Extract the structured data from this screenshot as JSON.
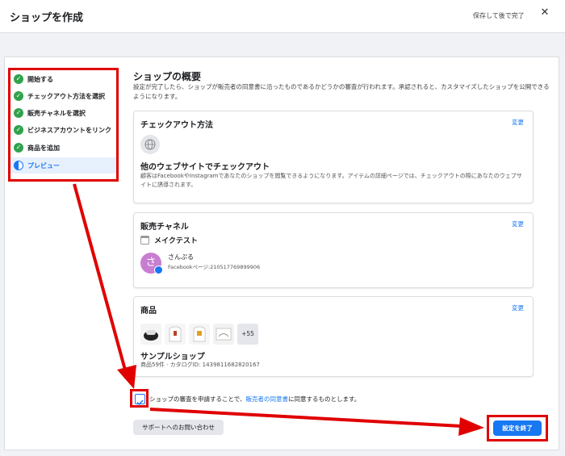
{
  "header": {
    "title": "ショップを作成",
    "save_later": "保存して後で完了",
    "close": "✕"
  },
  "sidebar": {
    "steps": [
      {
        "label": "開始する",
        "state": "done"
      },
      {
        "label": "チェックアウト方法を選択",
        "state": "done"
      },
      {
        "label": "販売チャネルを選択",
        "state": "done"
      },
      {
        "label": "ビジネスアカウントをリンク",
        "state": "done"
      },
      {
        "label": "商品を追加",
        "state": "done"
      },
      {
        "label": "プレビュー",
        "state": "active"
      }
    ]
  },
  "main": {
    "title": "ショップの概要",
    "description": "設定が完了したら、ショップが販売者の同意書に沿ったものであるかどうかの審査が行われます。承認されると、カスタマイズしたショップを公開できるようになります。",
    "checkout": {
      "title": "チェックアウト方法",
      "change": "変更",
      "method": "他のウェブサイトでチェックアウト",
      "detail": "顧客はFacebookやInstagramであなたのショップを閲覧できるようになります。アイテムの詳細ページでは、チェックアウトの際にあなたのウェブサイトに誘導されます。"
    },
    "channel": {
      "title": "販売チャネル",
      "change": "変更",
      "shop_name": "メイクテスト",
      "avatar_char": "さ",
      "page_name": "さんぷる",
      "page_id": "Facebookページ:210517769899906"
    },
    "products": {
      "title": "商品",
      "change": "変更",
      "more": "+55",
      "name": "サンプルショップ",
      "meta": "商品59件 · カタログID: 1439811682820167"
    },
    "agreement": {
      "prefix": "ショップの審査を申請することで、",
      "link": "販売者の同意書",
      "suffix": "に同意するものとします。"
    },
    "support_button": "サポートへのお問い合わせ",
    "finish_button": "設定を終了"
  },
  "colors": {
    "accent": "#1877f2",
    "success": "#31a24c",
    "annotation": "#e00000"
  }
}
